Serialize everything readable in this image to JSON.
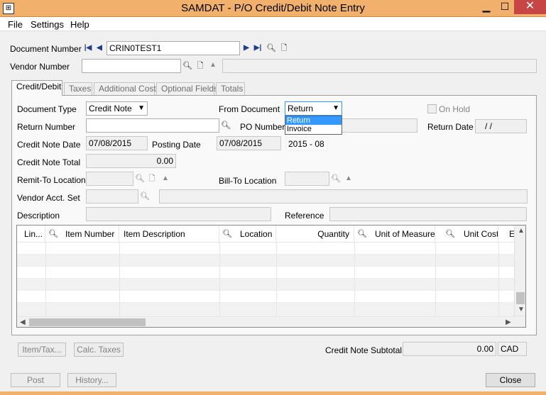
{
  "window": {
    "title": "SAMDAT - P/O Credit/Debit Note Entry",
    "minimize": "▁",
    "maximize": "☐",
    "close": "✕"
  },
  "menu": {
    "items": [
      "File",
      "Settings",
      "Help"
    ]
  },
  "header": {
    "document_number_label": "Document Number",
    "document_number_value": "CRIN0TEST1",
    "vendor_number_label": "Vendor Number",
    "vendor_number_value": "",
    "vendor_name_value": ""
  },
  "tabs": [
    "Credit/Debit",
    "Taxes",
    "Additional Costs",
    "Optional Fields",
    "Totals"
  ],
  "form": {
    "document_type_label": "Document Type",
    "document_type_value": "Credit Note",
    "from_document_label": "From Document",
    "from_document_value": "Return",
    "from_document_options": [
      "Return",
      "Invoice"
    ],
    "on_hold_label": "On Hold",
    "return_number_label": "Return Number",
    "return_number_value": "",
    "po_number_label": "PO Number",
    "po_number_value": "",
    "return_date_label": "Return Date",
    "return_date_value": "/  /",
    "credit_note_date_label": "Credit Note Date",
    "credit_note_date_value": "07/08/2015",
    "posting_date_label": "Posting Date",
    "posting_date_value": "07/08/2015",
    "period_value": "2015 - 08",
    "credit_note_total_label": "Credit Note Total",
    "credit_note_total_value": "0.00",
    "remit_to_location_label": "Remit-To Location",
    "bill_to_location_label": "Bill-To Location",
    "vendor_acct_set_label": "Vendor Acct. Set",
    "description_label": "Description",
    "reference_label": "Reference"
  },
  "grid": {
    "columns": [
      "Lin...",
      "Item Number",
      "Item Description",
      "Location",
      "Quantity",
      "Unit of Measure",
      "Unit Cost",
      "E"
    ]
  },
  "footer": {
    "item_tax_label": "Item/Tax...",
    "calc_taxes_label": "Calc. Taxes",
    "subtotal_label": "Credit Note Subtotal",
    "subtotal_value": "0.00",
    "currency": "CAD",
    "post_label": "Post",
    "history_label": "History...",
    "close_label": "Close"
  },
  "colors": {
    "title_bar": "#f1b06c",
    "selection": "#3399ff"
  }
}
